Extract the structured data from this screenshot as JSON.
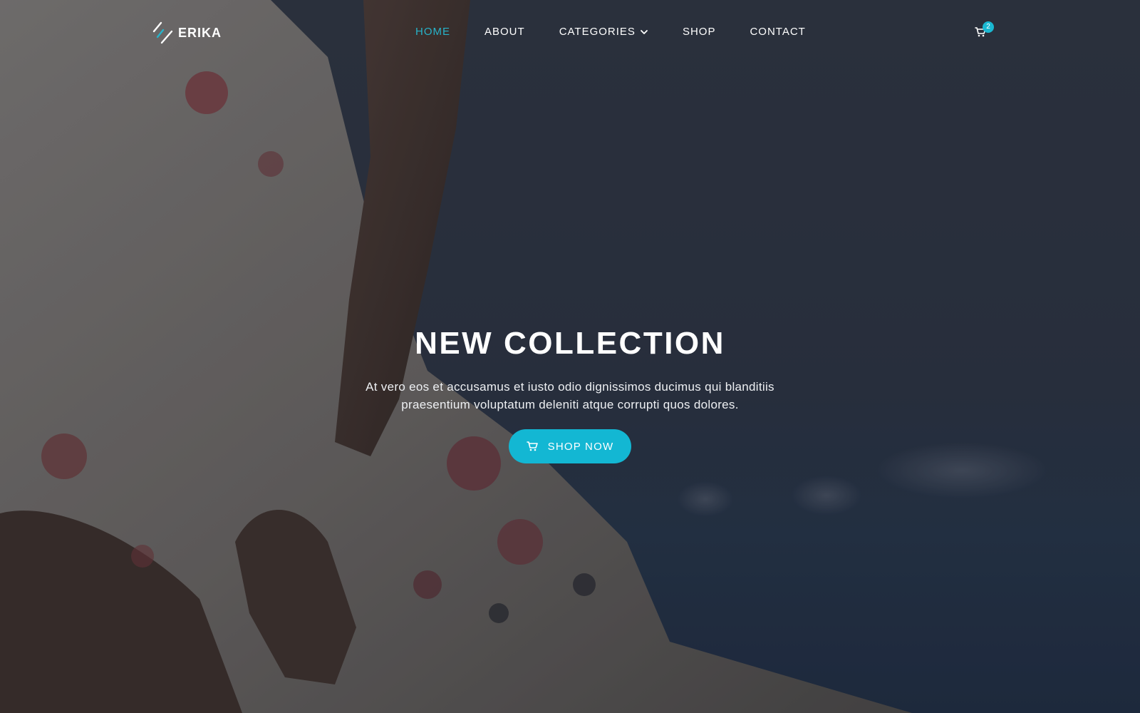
{
  "brand": {
    "name": "ERIKA",
    "icon": "erika-logo-icon"
  },
  "nav": {
    "items": [
      {
        "label": "HOME",
        "active": true
      },
      {
        "label": "ABOUT",
        "active": false
      },
      {
        "label": "CATEGORIES",
        "active": false,
        "icon": "chevron-down-icon"
      },
      {
        "label": "SHOP",
        "active": false
      },
      {
        "label": "CONTACT",
        "active": false
      }
    ]
  },
  "cart": {
    "icon": "shopping-cart-icon",
    "count": "2"
  },
  "hero": {
    "title": "NEW COLLECTION",
    "subtitle": "At vero eos et accusamus et iusto odio dignissimos ducimus qui blanditiis praesentium voluptatum deleniti atque corrupti quos dolores.",
    "button_label": "SHOP NOW",
    "button_icon": "cart-icon"
  },
  "colors": {
    "accent": "#13b7d3",
    "active_nav": "#27b3c9",
    "text": "#ffffff"
  }
}
